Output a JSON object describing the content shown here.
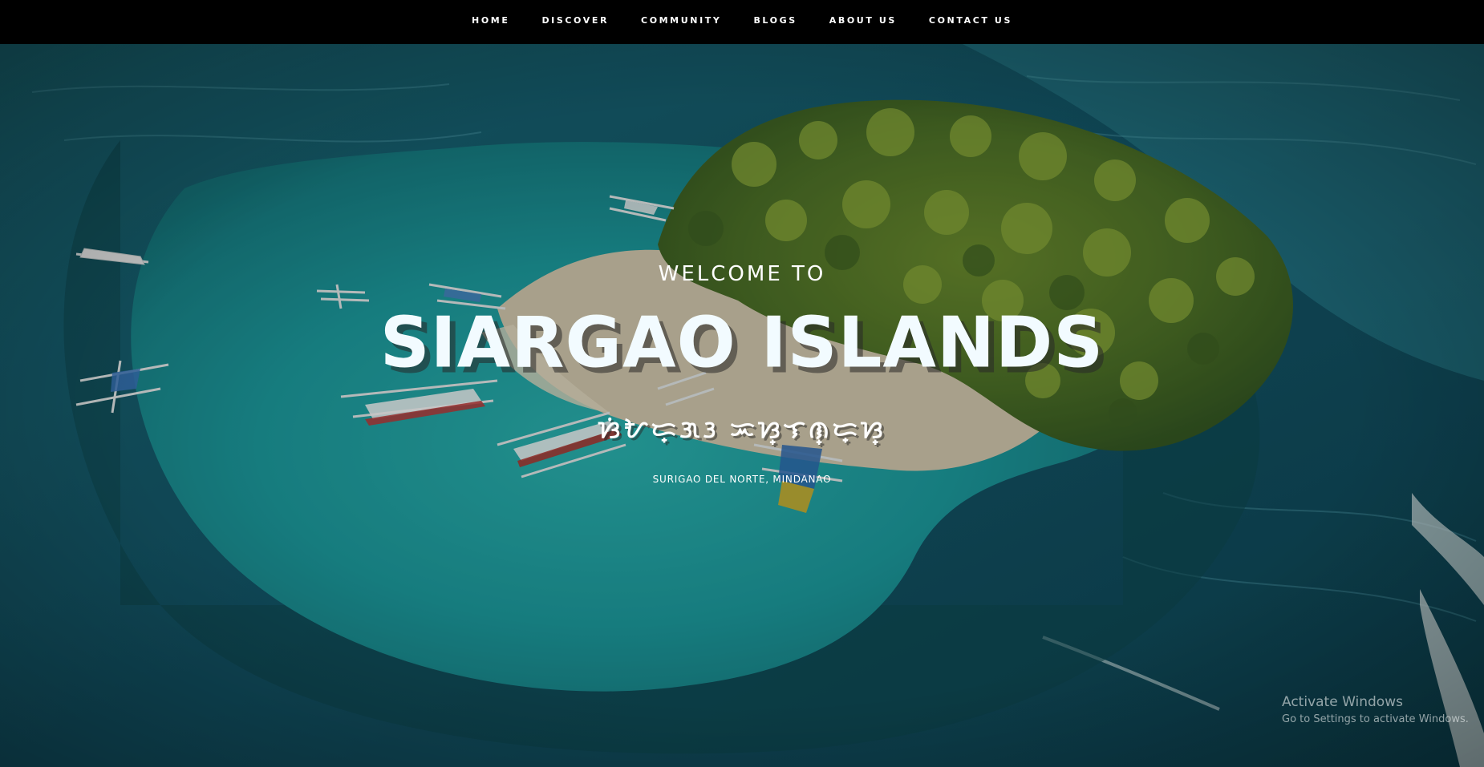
{
  "nav": {
    "items": [
      {
        "label": "HOME"
      },
      {
        "label": "DISCOVER"
      },
      {
        "label": "COMMUNITY"
      },
      {
        "label": "BLOGS"
      },
      {
        "label": "ABOUT US"
      },
      {
        "label": "CONTACT US"
      }
    ]
  },
  "hero": {
    "welcome": "WELCOME TO",
    "title": "SIARGAO ISLANDS",
    "script_text": "ᜐᜒᜀᜇ᜔ᜄᜂ ᜁᜐ᜔ᜎᜈ᜔ᜇ᜔ᜐ᜔",
    "location": "SURIGAO DEL NORTE, MINDANAO"
  },
  "watermark": {
    "line1": "Activate Windows",
    "line2": "Go to Settings to activate Windows."
  },
  "colors": {
    "nav_bg": "#000000",
    "ocean_deep": "#0f4f5c",
    "lagoon": "#1fa6a8",
    "sand": "#d9cfb4",
    "foliage": "#5a7d2a"
  }
}
